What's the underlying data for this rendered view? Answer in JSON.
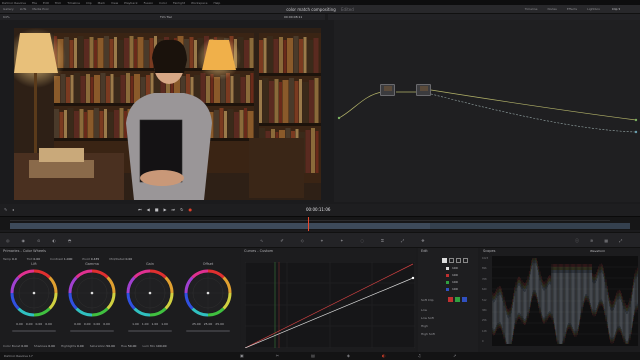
{
  "menubar": {
    "items": [
      "DaVinci Resolve",
      "File",
      "Edit",
      "Trim",
      "Timeline",
      "Clip",
      "Mark",
      "View",
      "Playback",
      "Fusion",
      "Color",
      "Fairlight",
      "Workspace",
      "Help"
    ]
  },
  "titlebar": {
    "left_items": [
      "Gallery",
      "LUTs",
      "Media Pool"
    ],
    "project": "color match compositing",
    "edited": "Edited",
    "right_items": [
      "Timeline",
      "Nodes",
      "Effects",
      "Lightbox"
    ],
    "clip_label": "Clip"
  },
  "viewer": {
    "zoom": "64%",
    "clip_name": "Tim Tiel",
    "timecode_left": "00:00:08:11",
    "timecode": "00:00:11:06"
  },
  "primaries": {
    "title": "Primaries - Color Wheels",
    "params_top": [
      {
        "label": "Temp",
        "value": "0.0"
      },
      {
        "label": "Tint",
        "value": "0.00"
      },
      {
        "label": "Contrast",
        "value": "1.000"
      },
      {
        "label": "Pivot",
        "value": "0.435"
      },
      {
        "label": "Mid/Detail",
        "value": "0.00"
      }
    ],
    "wheels": [
      {
        "label": "Lift",
        "values": [
          "0.00",
          "0.00",
          "0.00",
          "0.00"
        ],
        "color": "#8a3030"
      },
      {
        "label": "Gamma",
        "values": [
          "0.00",
          "0.00",
          "0.00",
          "0.00"
        ],
        "color": "#aa8030"
      },
      {
        "label": "Gain",
        "values": [
          "1.00",
          "1.00",
          "1.00",
          "1.00"
        ],
        "color": "#7040a0"
      },
      {
        "label": "Offset",
        "values": [
          "25.00",
          "25.00",
          "25.00"
        ],
        "color": "#206a6a"
      }
    ],
    "params_bottom": [
      {
        "label": "Color Boost",
        "value": "0.00"
      },
      {
        "label": "Shadows",
        "value": "0.00"
      },
      {
        "label": "Highlights",
        "value": "0.00"
      },
      {
        "label": "Saturation",
        "value": "50.00"
      },
      {
        "label": "Hue",
        "value": "50.00"
      },
      {
        "label": "Lum Mix",
        "value": "100.00"
      }
    ]
  },
  "curves": {
    "title": "Curves - Custom"
  },
  "edit_panel": {
    "title": "Edit",
    "values": [
      "100",
      "100",
      "100",
      "100"
    ],
    "soft_clip": "Soft Clip",
    "rows": [
      "Low",
      "Low Soft",
      "High",
      "High Soft"
    ]
  },
  "scopes": {
    "title": "Scopes",
    "mode": "Waveform",
    "ticks": [
      "1023",
      "896",
      "768",
      "640",
      "512",
      "384",
      "256",
      "128",
      "0"
    ]
  },
  "status": {
    "app": "DaVinci Resolve 17"
  },
  "colors": {
    "accent": "#e0402a",
    "playhead": "#e8482e"
  }
}
